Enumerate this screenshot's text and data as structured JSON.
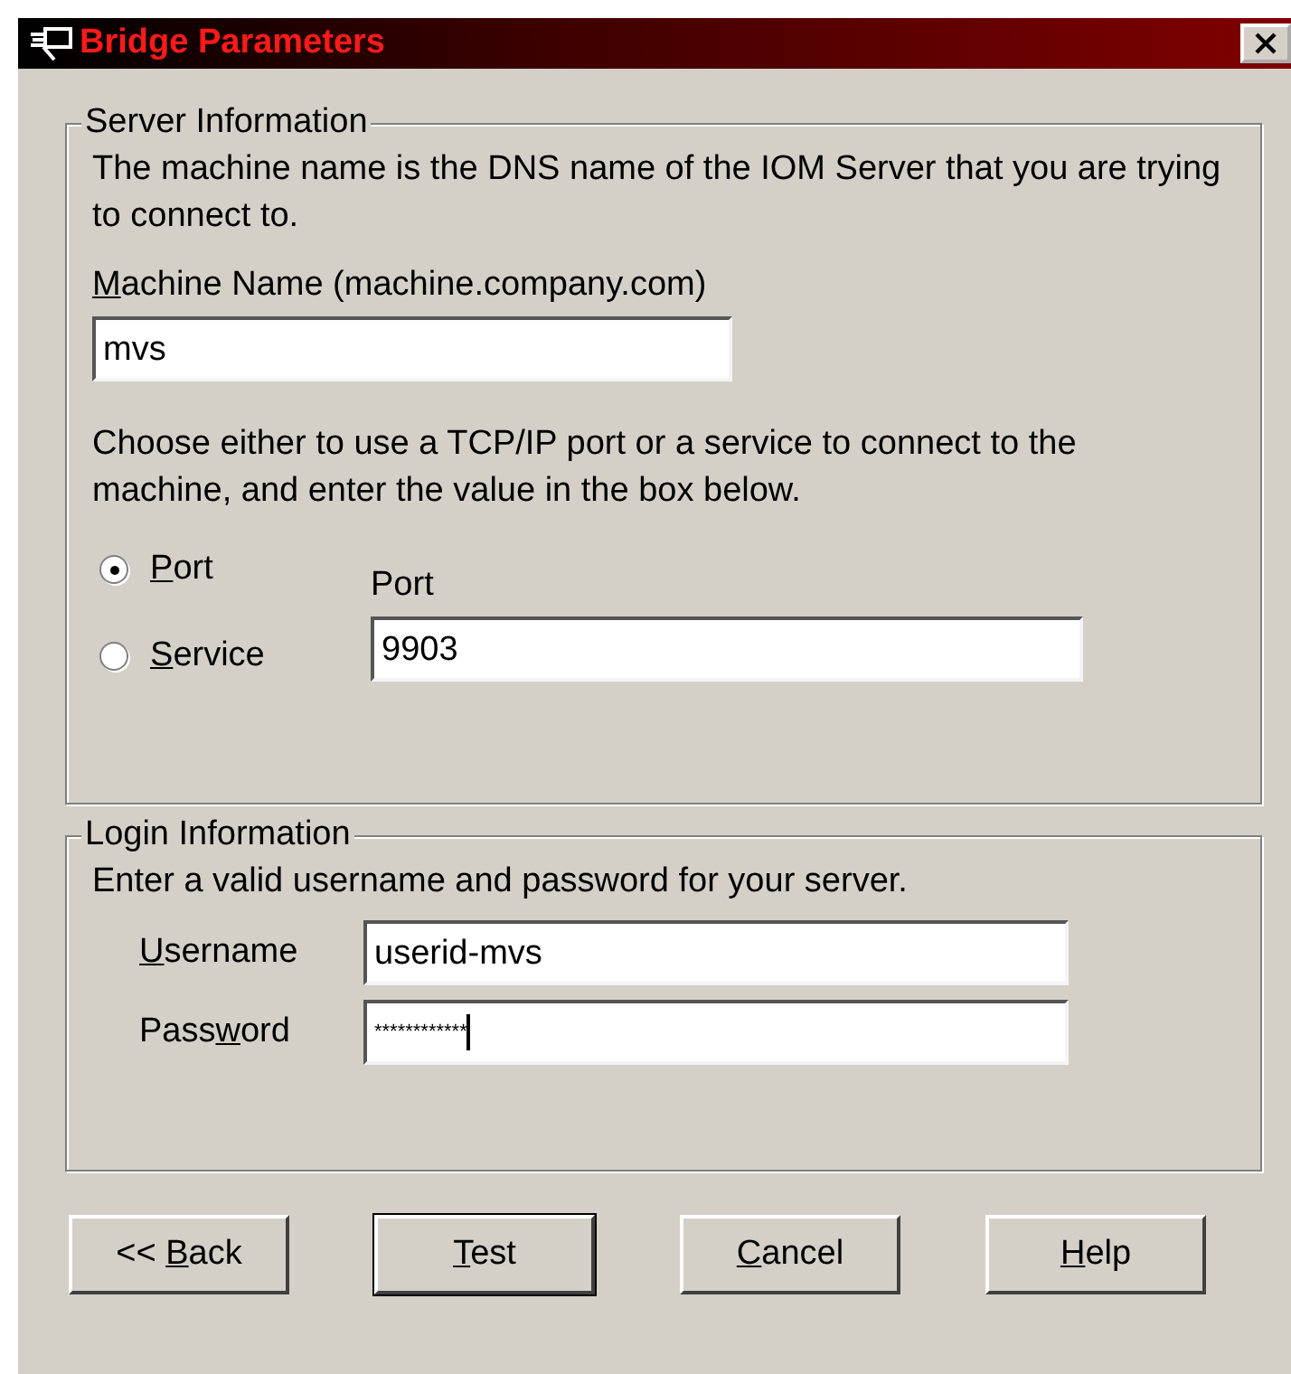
{
  "window": {
    "title": "Bridge Parameters"
  },
  "server_information": {
    "title": "Server Information",
    "description": "The machine name is the DNS name of the IOM Server that you are trying to connect to.",
    "machine_name": {
      "label": {
        "key": "M",
        "after": "achine Name (machine.company.com)"
      },
      "value": "mvs"
    },
    "instructions": "Choose either to use a TCP/IP port or a service to connect to the machine, and enter the value in the box below.",
    "connection_options": [
      {
        "label": {
          "key": "P",
          "after": "ort"
        },
        "selected": true
      },
      {
        "label": {
          "key": "S",
          "after": "ervice"
        },
        "selected": false
      }
    ],
    "port": {
      "label": "Port",
      "value": "9903"
    }
  },
  "login_information": {
    "title": "Login Information",
    "description": "Enter a valid username and password for your server.",
    "username": {
      "label": {
        "key": "U",
        "after": "sername"
      },
      "value": "userid-mvs"
    },
    "password": {
      "label": {
        "before": "Pass",
        "key": "w",
        "after": "ord"
      },
      "value": "************"
    }
  },
  "buttons": [
    {
      "label": {
        "before": "<< ",
        "key": "B",
        "after": "ack"
      },
      "default": false
    },
    {
      "label": {
        "key": "T",
        "after": "est"
      },
      "default": true
    },
    {
      "label": {
        "key": "C",
        "after": "ancel"
      },
      "default": false
    },
    {
      "label": {
        "key": "H",
        "after": "elp"
      },
      "default": false
    }
  ]
}
